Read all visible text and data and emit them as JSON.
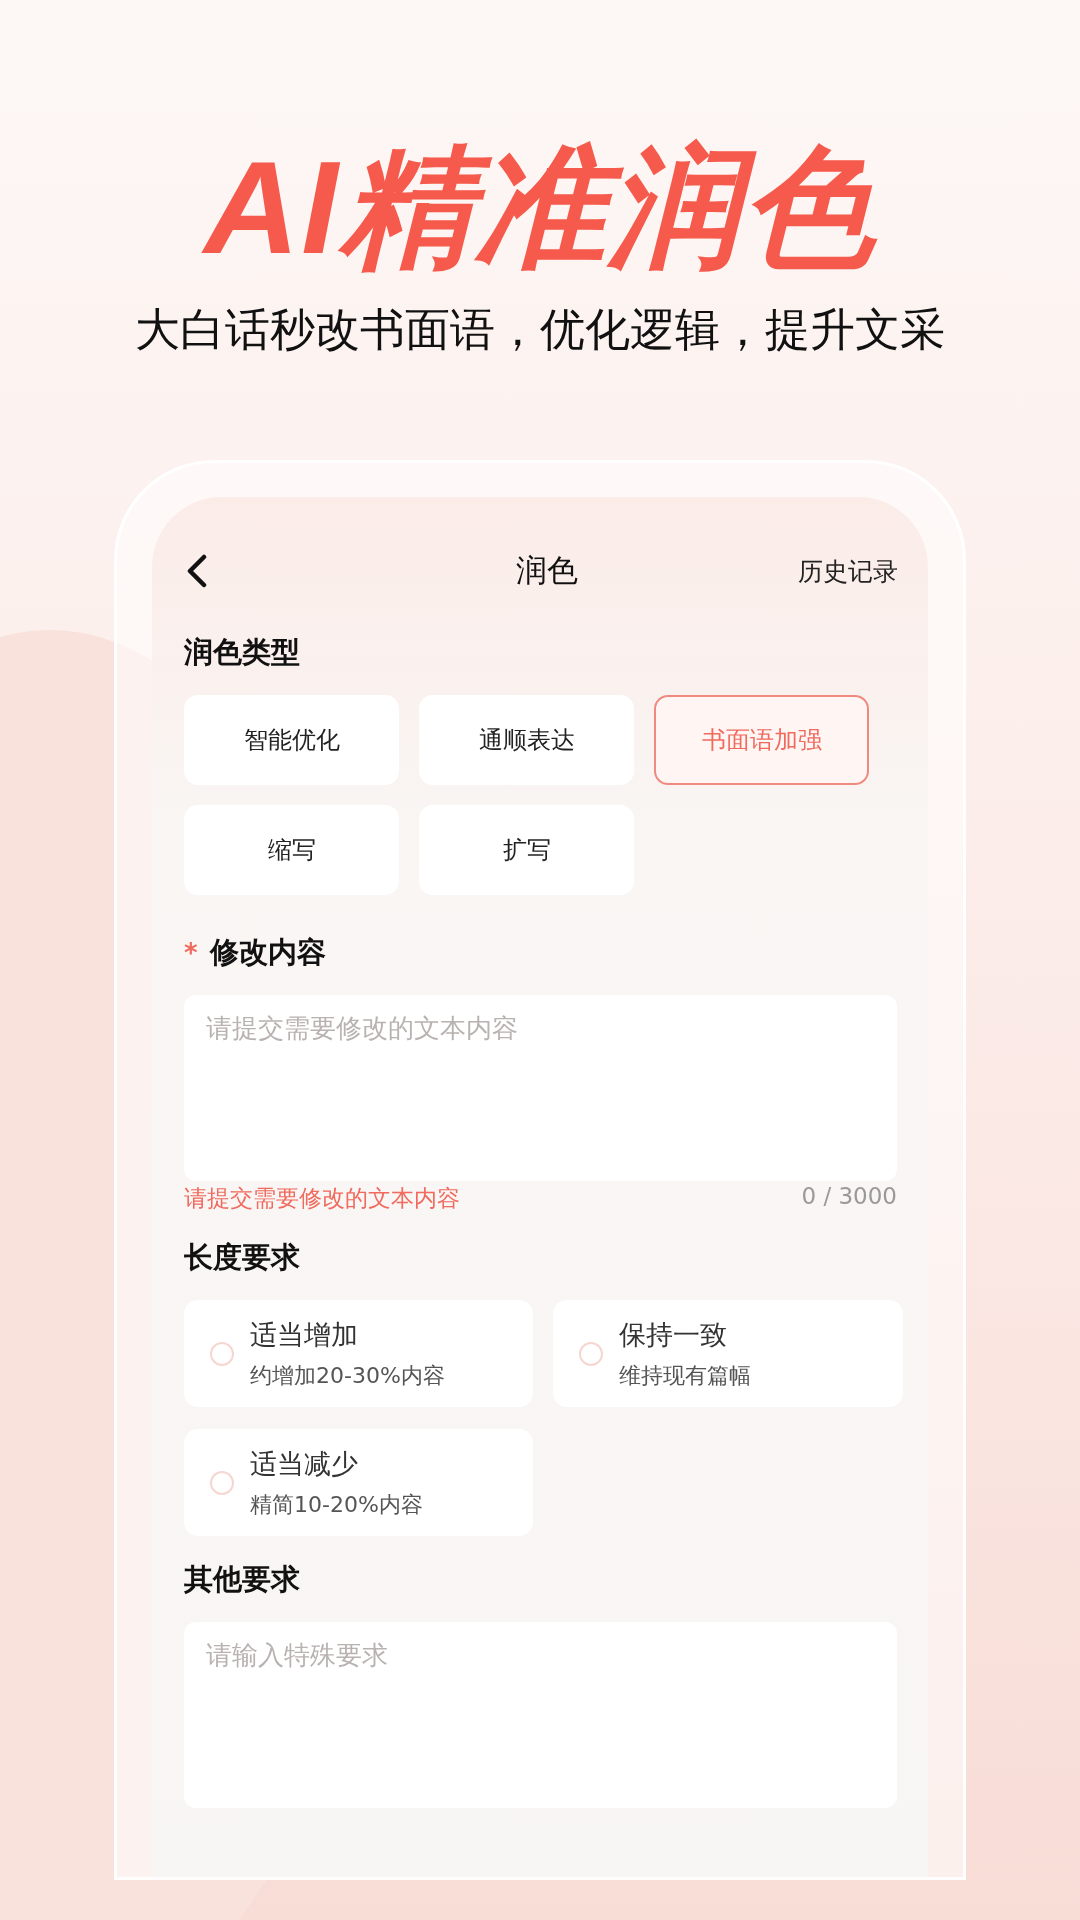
{
  "hero": {
    "title": "AI精准润色",
    "subtitle": "大白话秒改书面语，优化逻辑，提升文采"
  },
  "screen": {
    "title": "润色",
    "action": "历史记录",
    "polish_type": {
      "label": "润色类型",
      "options": [
        {
          "label": "智能优化",
          "selected": false
        },
        {
          "label": "通顺表达",
          "selected": false
        },
        {
          "label": "书面语加强",
          "selected": true
        },
        {
          "label": "缩写",
          "selected": false
        },
        {
          "label": "扩写",
          "selected": false
        }
      ]
    },
    "content": {
      "required_mark": "*",
      "label": "修改内容",
      "placeholder": "请提交需要修改的文本内容",
      "error": "请提交需要修改的文本内容",
      "counter": "0 / 3000"
    },
    "length": {
      "label": "长度要求",
      "options": [
        {
          "title": "适当增加",
          "note": "约增加20-30%内容",
          "selected": false
        },
        {
          "title": "保持一致",
          "note": "维持现有篇幅",
          "selected": false
        },
        {
          "title": "适当减少",
          "note": "精简10-20%内容",
          "selected": false
        }
      ]
    },
    "other": {
      "label": "其他要求",
      "placeholder": "请输入特殊要求"
    }
  }
}
